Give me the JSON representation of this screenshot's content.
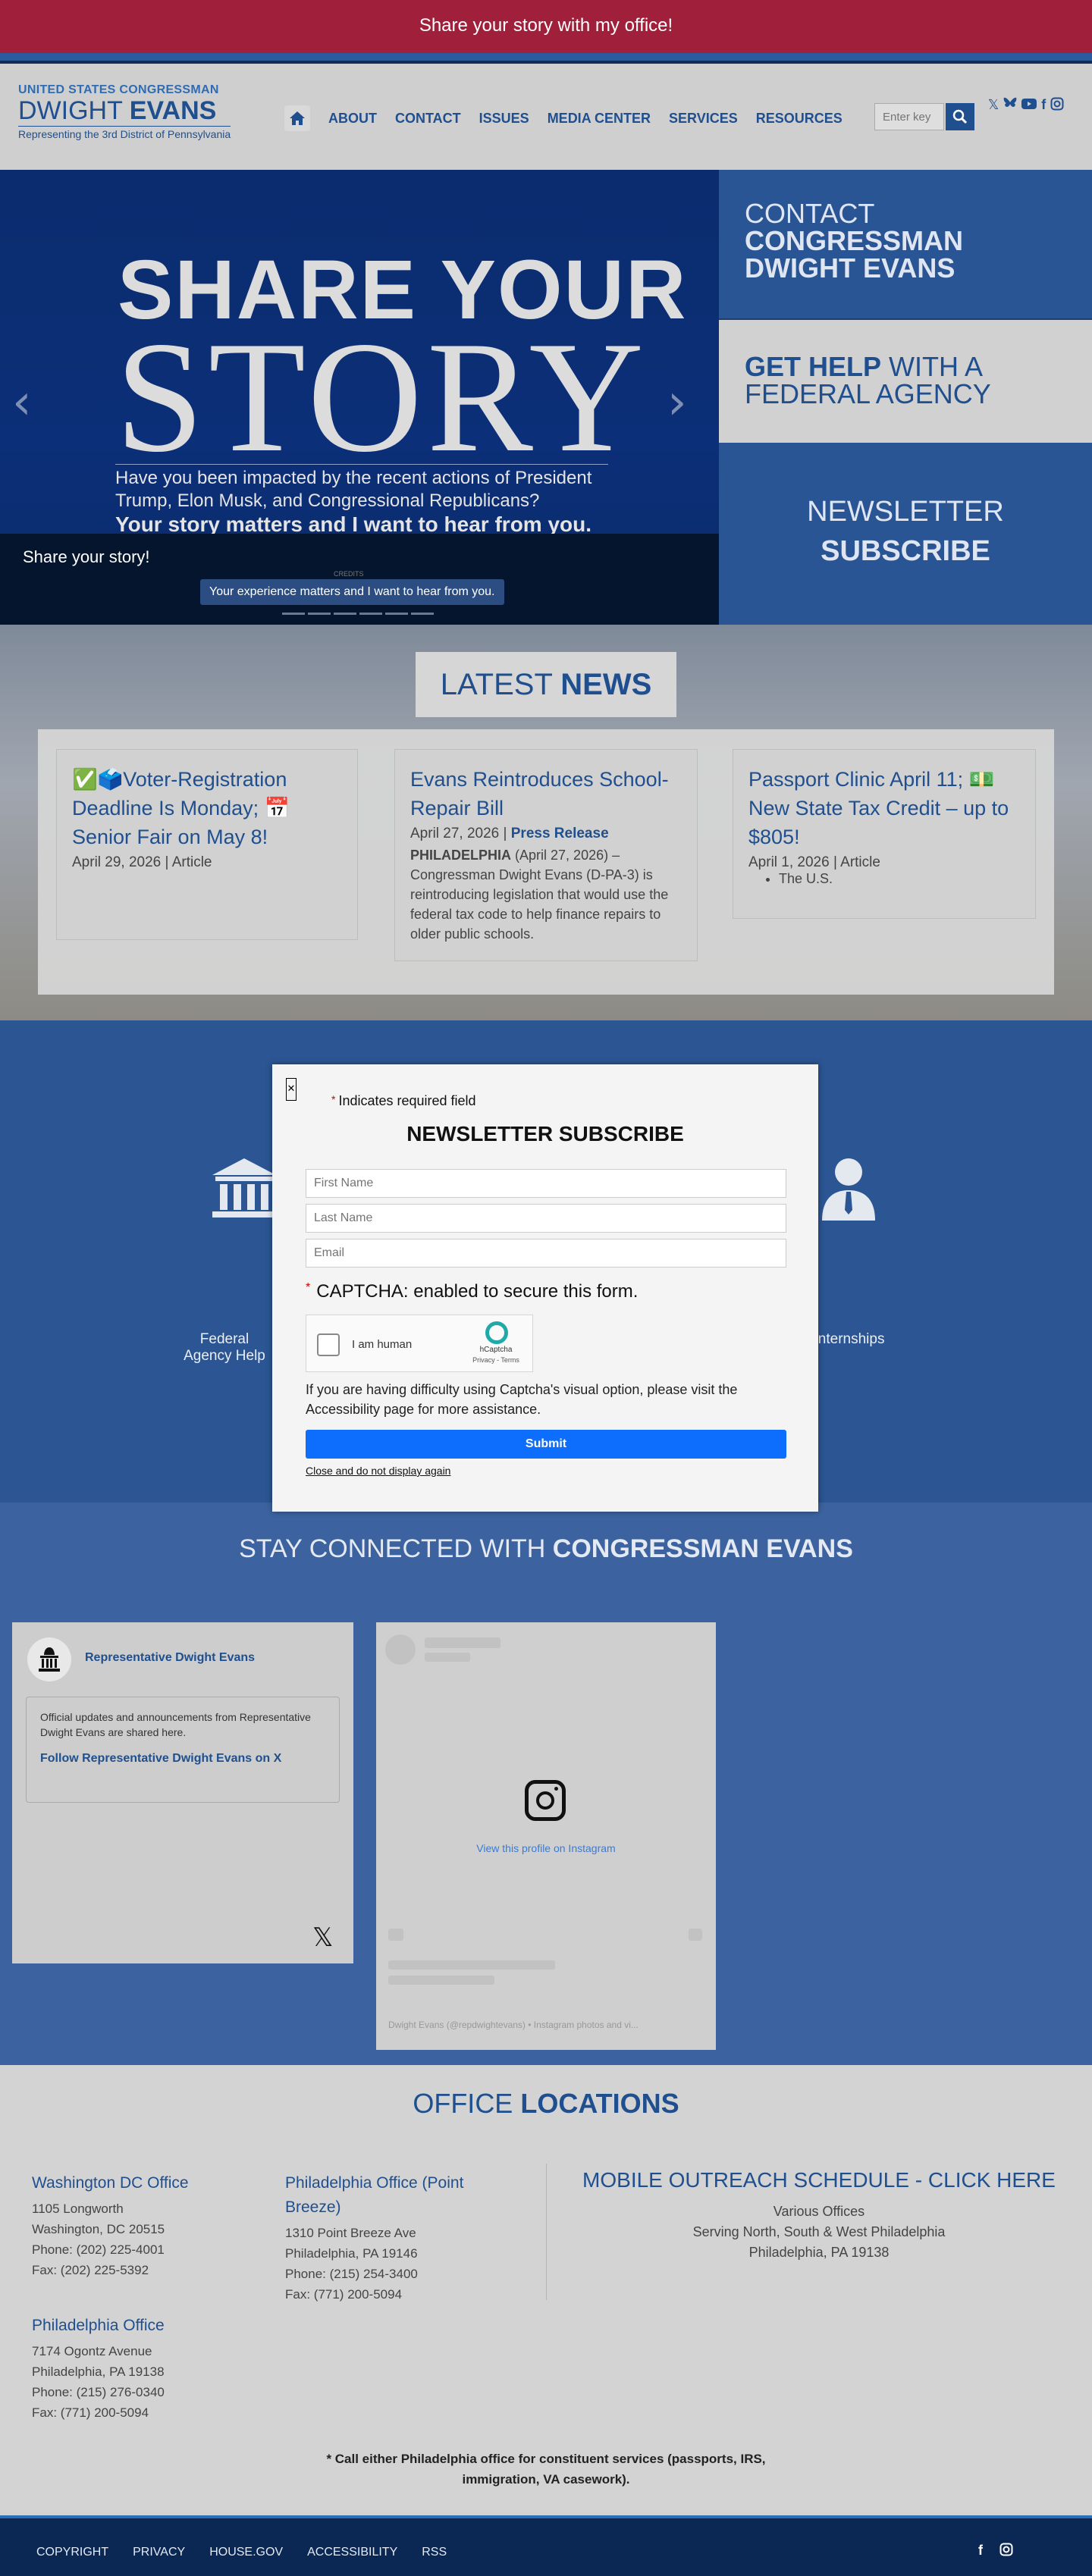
{
  "topbar": {
    "text": "Share your story with my office!"
  },
  "logo": {
    "line1": "UNITED STATES CONGRESSMAN",
    "first": "DWIGHT ",
    "last": "EVANS",
    "tagline": "Representing the 3rd District of Pennsylvania"
  },
  "nav": {
    "items": [
      "ABOUT",
      "CONTACT",
      "ISSUES",
      "MEDIA CENTER",
      "SERVICES",
      "RESOURCES"
    ]
  },
  "search": {
    "placeholder": "Enter key"
  },
  "hero": {
    "title1": "SHARE YOUR",
    "title2": "STORY",
    "paragraph": "Have you been impacted by the recent actions of President Trump, Elon Musk, and Congressional Republicans?",
    "paragraph2": "Your story matters and I want to hear from you.",
    "caption_title": "Share your story!",
    "caption_sub": "Your experience matters and I want to hear from you.",
    "credits": "CREDITS"
  },
  "side_links": {
    "contact": [
      "CONTACT",
      "CONGRESSMAN",
      "DWIGHT EVANS"
    ],
    "help": [
      "GET HELP",
      " WITH A",
      "FEDERAL AGENCY"
    ],
    "newsletter": [
      "NEWSLETTER",
      "SUBSCRIBE"
    ]
  },
  "news": {
    "title_a": "LATEST ",
    "title_b": "NEWS",
    "cards": [
      {
        "title": "✅🗳️Voter-Registration Deadline Is Monday; 📅Senior Fair on May 8!",
        "date": "April 29, 2026",
        "type": "Article"
      },
      {
        "title": "Evans Reintroduces School-Repair Bill",
        "date": "April 27, 2026",
        "type": "Press Release",
        "lead": "PHILADELPHIA",
        "body": "(April 27, 2026) – Congressman Dwight Evans (D-PA-3) is reintroducing legislation that would use the federal tax code to help finance repairs to older public schools."
      },
      {
        "title": "Passport Clinic April 11; 💵 New State Tax Credit – up to $805!",
        "date": "April 1, 2026",
        "type": "Article",
        "bullet": "The U.S."
      }
    ]
  },
  "services": {
    "left_label": "Federal Agency Help",
    "right_label": "Internships"
  },
  "modal": {
    "required": "Indicates required field",
    "title": "NEWSLETTER SUBSCRIBE",
    "first_name": "First Name",
    "last_name": "Last Name",
    "email": "Email",
    "captcha_label": "CAPTCHA: enabled to secure this form.",
    "human": "I am human",
    "hcaptcha": "hCaptcha",
    "hcaptcha_links": "Privacy - Terms",
    "help_text": "If you are having difficulty using Captcha's visual option, please visit the Accessibility page for more assistance.",
    "submit": "Submit",
    "close_link": "Close and do not display again"
  },
  "connected": {
    "title_a": "STAY CONNECTED WITH ",
    "title_b": "CONGRESSMAN EVANS",
    "x_name": "Representative Dwight Evans",
    "x_desc": "Official updates and announcements from Representative Dwight Evans are shared here.",
    "x_follow": "Follow Representative Dwight Evans on X",
    "ig_view": "View this profile on Instagram",
    "ig_footer": "Dwight Evans (@repdwightevans) • Instagram photos and vi..."
  },
  "offices": {
    "title_a": "OFFICE ",
    "title_b": "LOCATIONS",
    "dc": {
      "name": "Washington DC Office",
      "lines": [
        "1105 Longworth",
        "Washington, DC 20515",
        "Phone: (202) 225-4001",
        "Fax: (202) 225-5392"
      ]
    },
    "pb": {
      "name": "Philadelphia Office (Point Breeze)",
      "lines": [
        "1310 Point Breeze Ave",
        "Philadelphia, PA 19146",
        "Phone: (215) 254-3400",
        "Fax: (771) 200-5094"
      ]
    },
    "ph": {
      "name": "Philadelphia Office",
      "lines": [
        "7174 Ogontz Avenue",
        "Philadelphia, PA 19138",
        "Phone: (215) 276-0340",
        "Fax: (771) 200-5094"
      ]
    },
    "mobile": {
      "name": "MOBILE OUTREACH SCHEDULE - CLICK HERE",
      "lines": [
        "Various Offices",
        "Serving North, South & West Philadelphia",
        "Philadelphia, PA 19138"
      ]
    },
    "note": "* Call either Philadelphia office for constituent services (passports, IRS, immigration, VA casework)."
  },
  "footer": {
    "links": [
      "COPYRIGHT",
      "PRIVACY",
      "HOUSE.GOV",
      "ACCESSIBILITY",
      "RSS"
    ]
  },
  "colors": {
    "brand": "#1f4f8e",
    "topbar": "#a01f3b",
    "footer": "#0b2854",
    "submit": "#0d6efd"
  }
}
